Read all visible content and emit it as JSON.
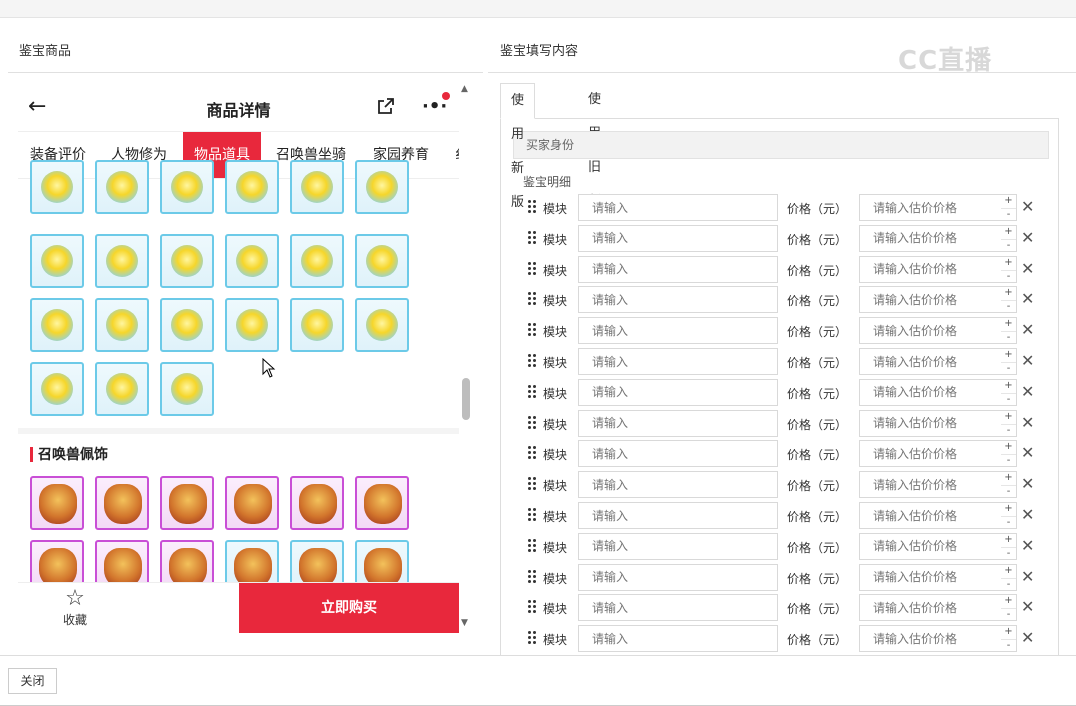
{
  "left_section": {
    "title": "鉴宝商品"
  },
  "right_section": {
    "title": "鉴宝填写内容"
  },
  "watermark": {
    "text": "CC直播"
  },
  "phone": {
    "back_icon": "back-arrow-icon",
    "title": "商品详情",
    "share_icon": "share-icon",
    "more_icon": "more-icon",
    "tabs": [
      "装备评价",
      "人物修为",
      "物品道具",
      "召唤兽坐骑",
      "家园养育",
      "纟"
    ],
    "active_tab": "物品道具",
    "orb_rows": [
      6,
      6,
      6,
      3
    ],
    "category": "召唤兽佩饰",
    "favorite_label": "收藏",
    "favorite_icon": "star-icon",
    "buy_button": "立即购买"
  },
  "form": {
    "tabs": [
      "使用新版",
      "使用旧版"
    ],
    "active_tab": "使用新版",
    "buyer_identity_label": "买家身份",
    "detail_label": "鉴宝明细",
    "row_label": "模块",
    "row_placeholder": "请输入",
    "price_label": "价格（元）",
    "price_placeholder": "请输入估价价格",
    "plus": "+",
    "minus": "-",
    "delete_icon": "✕",
    "row_count": 15
  },
  "footer": {
    "close_button": "关闭"
  }
}
